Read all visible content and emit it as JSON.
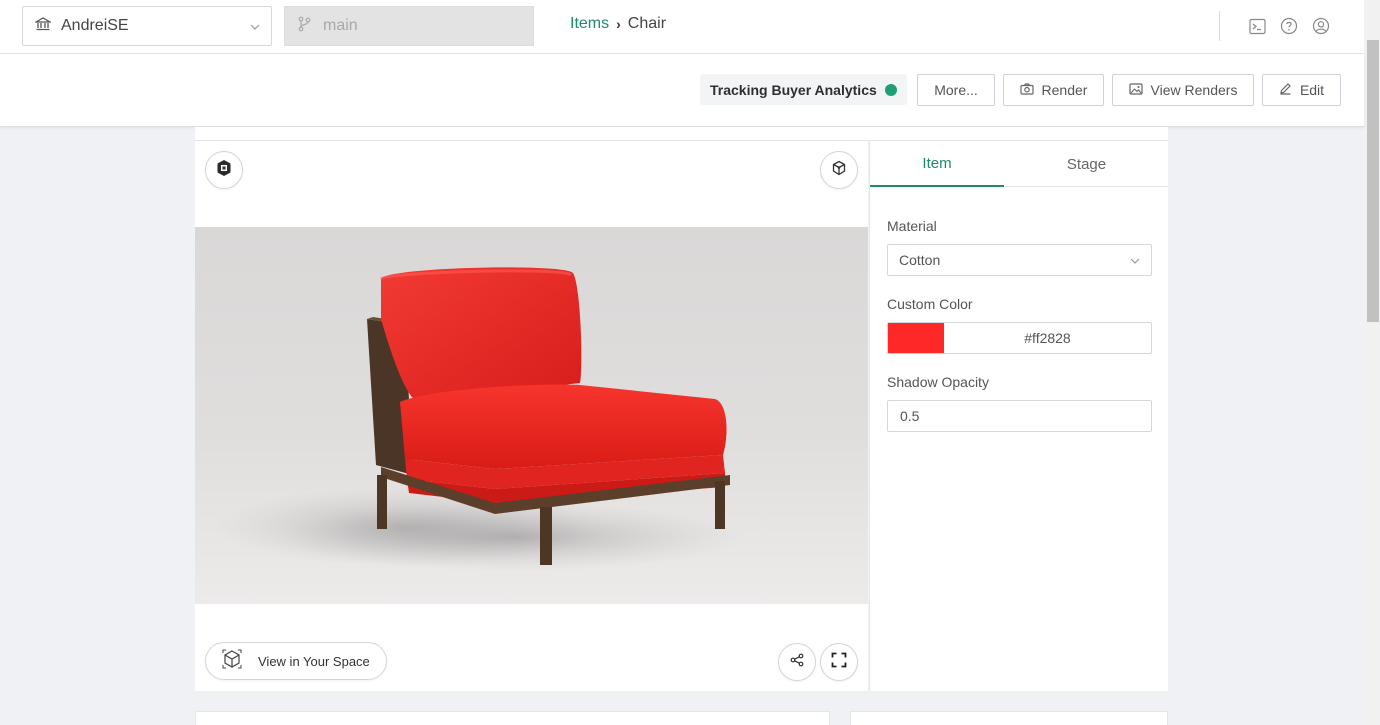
{
  "nav": {
    "org_name": "AndreiSE",
    "branch_placeholder": "main",
    "breadcrumb": {
      "parent": "Items",
      "current": "Chair"
    }
  },
  "actions": {
    "tracking_label": "Tracking Buyer Analytics",
    "tracking_color": "#1f9e75",
    "more_label": "More...",
    "render_label": "Render",
    "view_renders_label": "View Renders",
    "edit_label": "Edit"
  },
  "viewer": {
    "ar_label": "View in Your Space"
  },
  "panel": {
    "tabs": [
      {
        "label": "Item",
        "active": true
      },
      {
        "label": "Stage",
        "active": false
      }
    ],
    "material": {
      "label": "Material",
      "value": "Cotton"
    },
    "custom_color": {
      "label": "Custom Color",
      "value": "#ff2828"
    },
    "shadow_opacity": {
      "label": "Shadow Opacity",
      "value": "0.5"
    }
  },
  "colors": {
    "accent": "#1f8a6c",
    "chair_fabric": "#ff2828"
  }
}
